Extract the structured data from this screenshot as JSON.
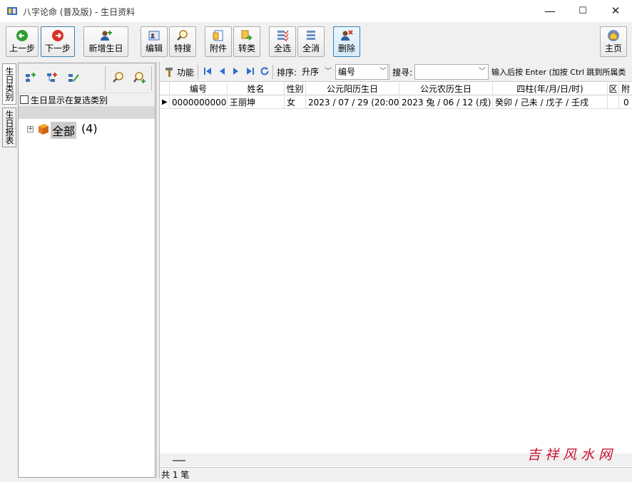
{
  "window": {
    "title": "八字论命 (普及版) - 生日资料",
    "minimize": "—",
    "maximize": "☐",
    "close": "✕"
  },
  "toolbar": {
    "prev": "上一步",
    "next": "下一步",
    "add_birthday": "新增生日",
    "edit": "编辑",
    "special_search": "特搜",
    "attachment": "附件",
    "transfer": "转类",
    "select_all": "全选",
    "deselect_all": "全消",
    "delete": "删除",
    "home": "主页"
  },
  "vertical_tabs": [
    "生日类别",
    "生日报表"
  ],
  "left_panel": {
    "checkbox_label": "生日显示在复选类别",
    "tree": {
      "expander": "+",
      "label": "全部",
      "count": "(4)"
    }
  },
  "nav": {
    "function": "功能",
    "sort_label": "排序:",
    "sort_order": "升序",
    "sort_field": "编号",
    "search_label": "搜寻:",
    "search_value": "",
    "hint": "输入后按 Enter (加按 Ctrl 跳到所属类"
  },
  "grid": {
    "columns": [
      "编号",
      "姓名",
      "性别",
      "公元阳历生日",
      "公元农历生日",
      "四柱(年/月/日/时)",
      "区",
      "附"
    ],
    "rows": [
      [
        "0000000000",
        "王丽坤",
        "女",
        "2023 / 07 / 29 (20:00)",
        "2023 兔 / 06 / 12 (戌)",
        "癸卯 / 己未 / 戊子 / 壬戌",
        "",
        "0"
      ]
    ]
  },
  "status": "共 1 笔",
  "watermark": "吉祥风水网",
  "colors": {
    "accent": "#3c7fb1",
    "watermark": "#c8102e",
    "prev_green": "#2e9e2e",
    "next_red": "#d93025"
  }
}
